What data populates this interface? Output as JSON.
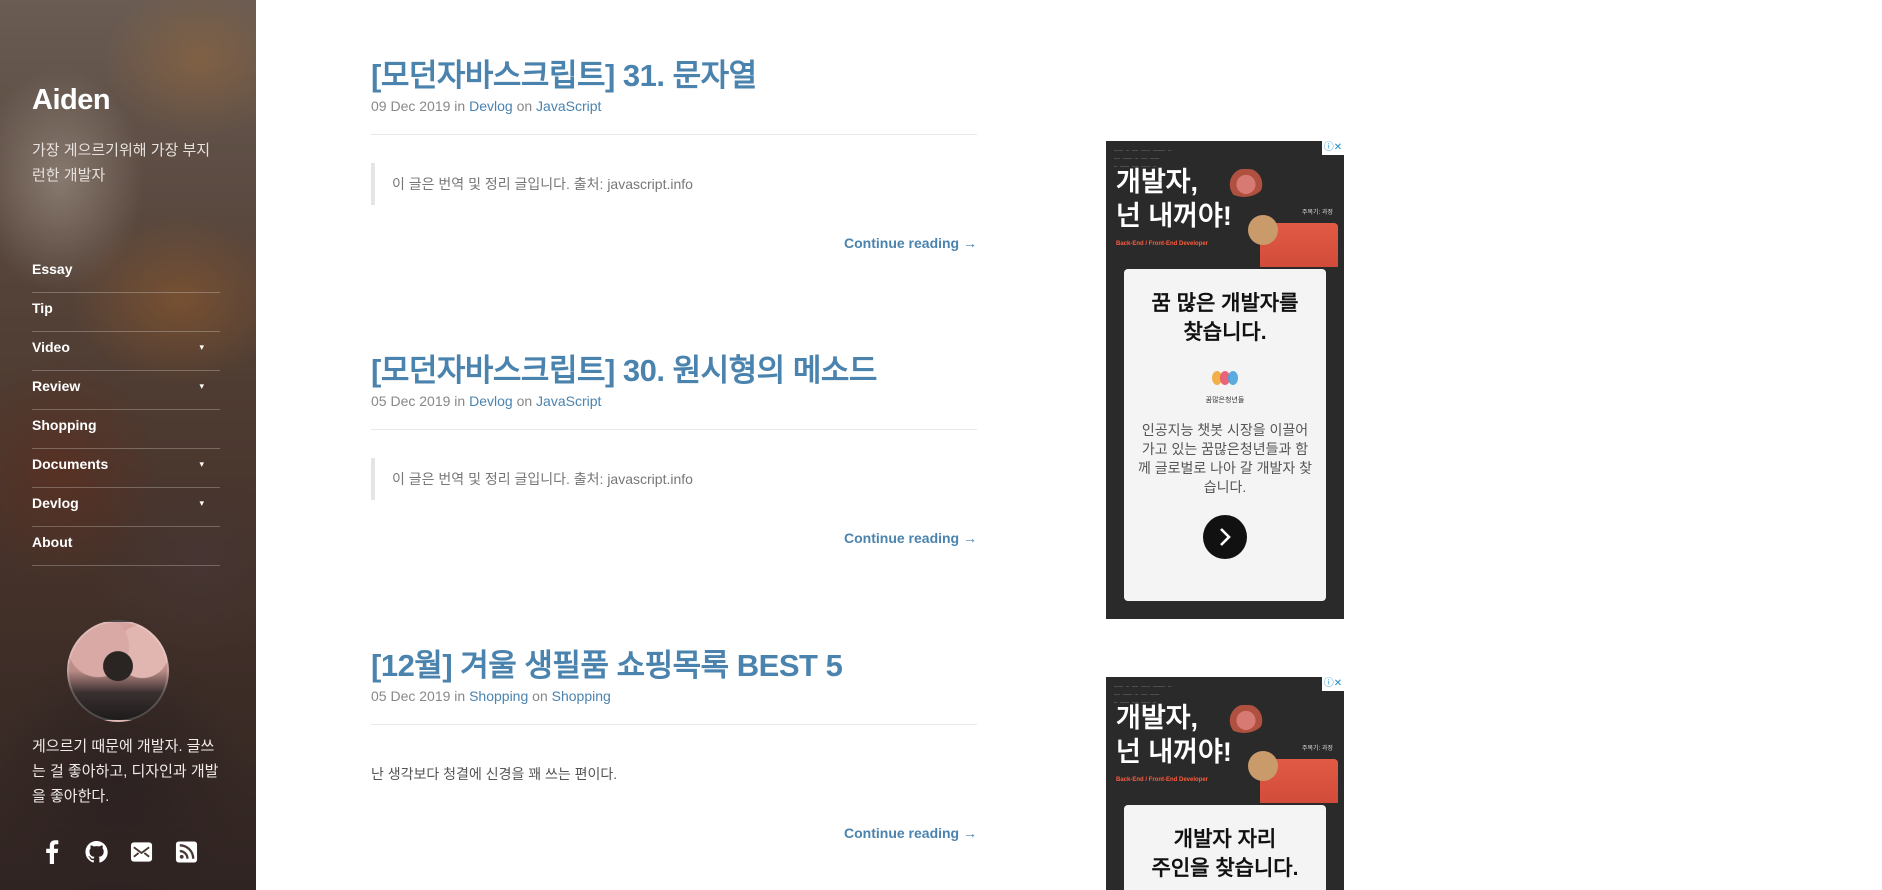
{
  "sidebar": {
    "title": "Aiden",
    "description": "가장 게으르기위해 가장 부지런한 개발자",
    "nav": [
      {
        "label": "Essay",
        "has_submenu": false
      },
      {
        "label": "Tip",
        "has_submenu": false
      },
      {
        "label": "Video",
        "has_submenu": true
      },
      {
        "label": "Review",
        "has_submenu": true
      },
      {
        "label": "Shopping",
        "has_submenu": false
      },
      {
        "label": "Documents",
        "has_submenu": true
      },
      {
        "label": "Devlog",
        "has_submenu": true
      },
      {
        "label": "About",
        "has_submenu": false
      }
    ],
    "submenu_caret": "▾",
    "bio": "게으르기 때문에 개발자. 글쓰는 걸 좋아하고, 디자인과 개발을 좋아한다.",
    "socials": [
      "facebook-icon",
      "github-icon",
      "mail-icon",
      "rss-icon"
    ]
  },
  "posts": [
    {
      "title": "[모던자바스크립트] 31. 문자열",
      "date": "09 Dec 2019",
      "in_word": "in",
      "category": "Devlog",
      "on_word": "on",
      "tag": "JavaScript",
      "excerpt": "이 글은 번역 및 정리 글입니다. 출처: javascript.info",
      "excerpt_style": "quote",
      "continue": "Continue reading →"
    },
    {
      "title": "[모던자바스크립트] 30. 원시형의 메소드",
      "date": "05 Dec 2019",
      "in_word": "in",
      "category": "Devlog",
      "on_word": "on",
      "tag": "JavaScript",
      "excerpt": "이 글은 번역 및 정리 글입니다. 출처: javascript.info",
      "excerpt_style": "quote",
      "continue": "Continue reading →"
    },
    {
      "title": "[12월] 겨울 생필품 쇼핑목록 BEST 5",
      "date": "05 Dec 2019",
      "in_word": "in",
      "category": "Shopping",
      "on_word": "on",
      "tag": "Shopping",
      "excerpt": "난 생각보다 청결에 신경을 꽤 쓰는 편이다.",
      "excerpt_style": "plain",
      "continue": "Continue reading →"
    }
  ],
  "ads": [
    {
      "badge": "ⓘ✕",
      "headline_line1": "개발자,",
      "headline_line2": "넌 내꺼야!",
      "subline": "Back-End / Front-End Developer",
      "tag": "주목기: 과정",
      "card_title_line1": "꿈 많은 개발자를",
      "card_title_line2": "찾습니다.",
      "logo_text": "꿈많은청년들",
      "body": "인공지능 챗봇 시장을 이끌어가고 있는 꿈많은청년들과 함께 글로벌로 나아 갈 개발자 찾습니다.",
      "go_icon": "chevron-right-icon"
    },
    {
      "badge": "ⓘ✕",
      "headline_line1": "개발자,",
      "headline_line2": "넌 내꺼야!",
      "subline": "Back-End / Front-End Developer",
      "tag": "주목기: 과정",
      "card_title_line1": "개발자 자리",
      "card_title_line2": "주인을 찾습니다."
    }
  ],
  "colors": {
    "link": "#4a83ae",
    "meta": "#888888",
    "ad_bg": "#2a2a2a",
    "ad_accent": "#ff5a3c"
  }
}
